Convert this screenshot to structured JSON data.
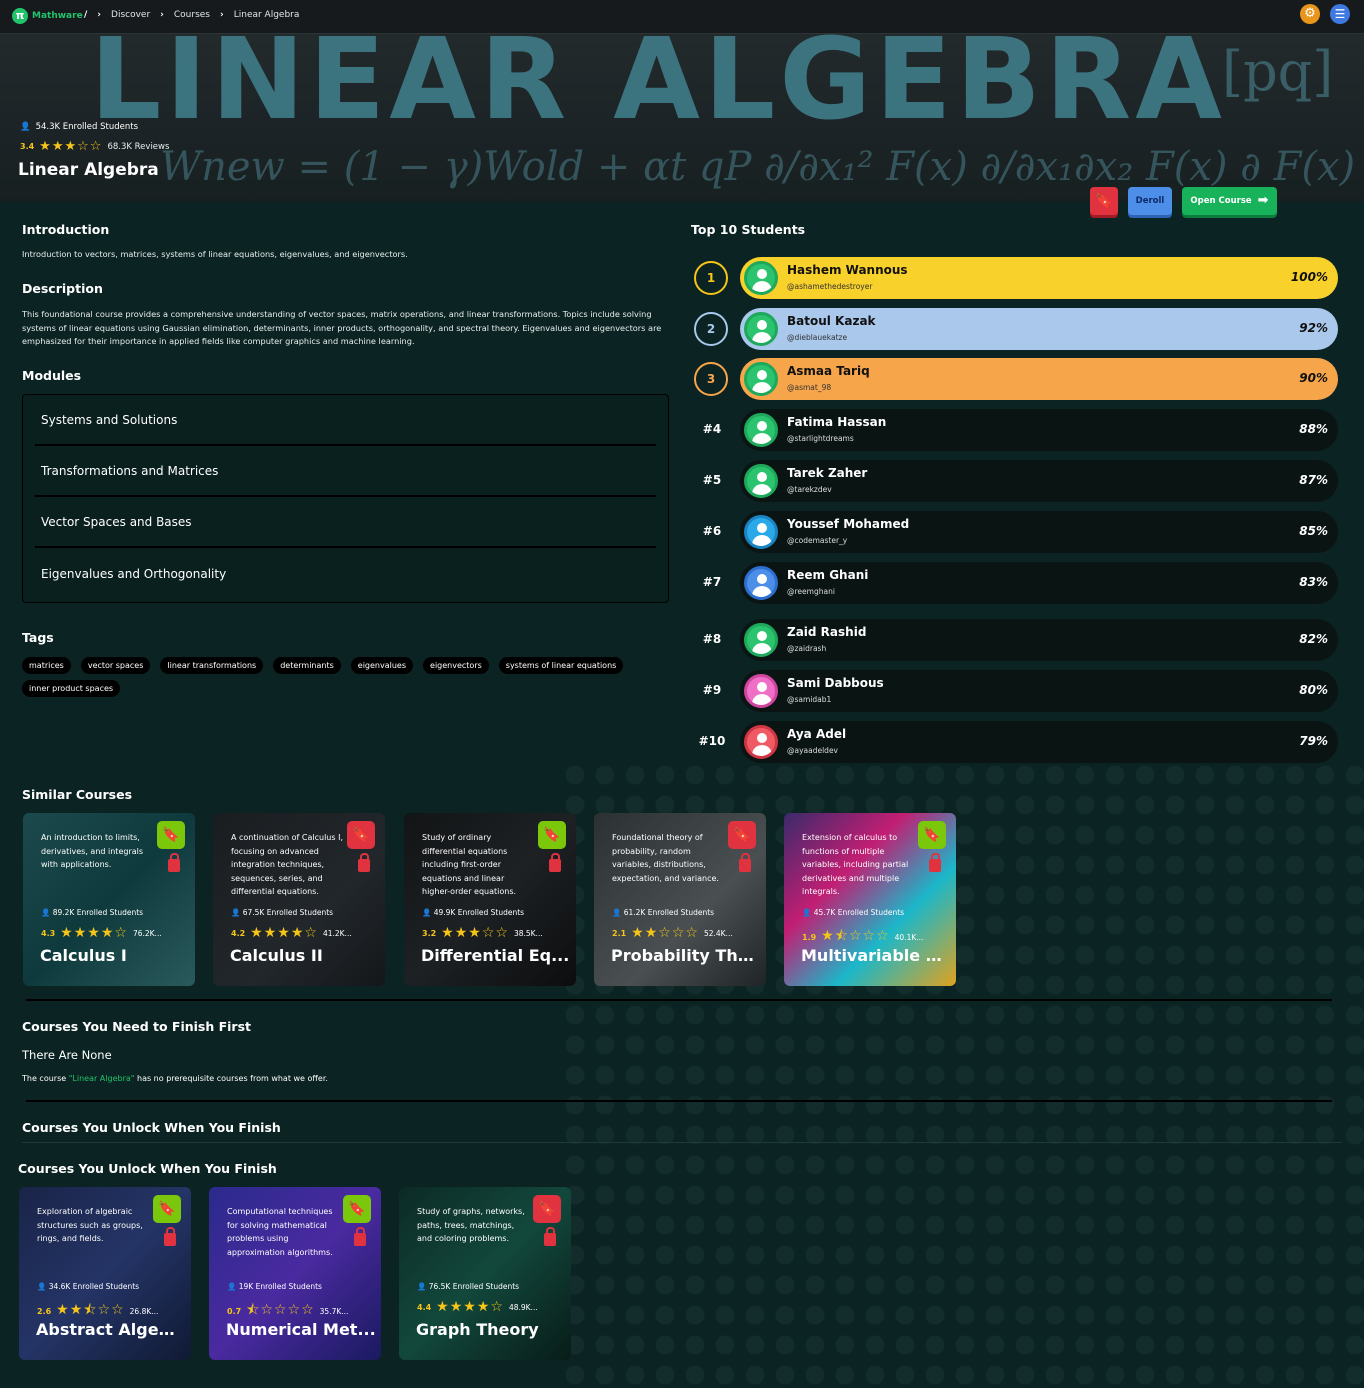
{
  "header": {
    "brand": "Mathware",
    "breadcrumbs": [
      "Discover",
      "Courses",
      "Linear Algebra"
    ],
    "settings_icon": "gear-icon",
    "menu_icon": "menu-icon"
  },
  "hero": {
    "banner_text": "LINEAR ALGEBRA",
    "banner_formula": "Wnew = (1 − γ)Wold + αt qP  ∂/∂x₁² F(x)  ∂/∂x₁∂x₂ F(x)  ∂ F(x)",
    "banner_matrix": "[pq]",
    "enrolled": "54.3K Enrolled Students",
    "rating": "3.4",
    "rating_value": 3.4,
    "reviews": "68.3K Reviews",
    "title": "Linear Algebra",
    "deroll_label": "Deroll",
    "open_label": "Open Course"
  },
  "introduction": {
    "heading": "Introduction",
    "text": "Introduction to vectors, matrices, systems of linear equations, eigenvalues, and eigenvectors."
  },
  "description": {
    "heading": "Description",
    "text": "This foundational course provides a comprehensive understanding of vector spaces, matrix operations, and linear transformations. Topics include solving systems of linear equations using Gaussian elimination, determinants, inner products, orthogonality, and spectral theory. Eigenvalues and eigenvectors are emphasized for their importance in applied fields like computer graphics and machine learning."
  },
  "modules": {
    "heading": "Modules",
    "items": [
      "Systems and Solutions",
      "Transformations and Matrices",
      "Vector Spaces and Bases",
      "Eigenvalues and Orthogonality"
    ]
  },
  "tags": {
    "heading": "Tags",
    "items": [
      "matrices",
      "vector spaces",
      "linear transformations",
      "determinants",
      "eigenvalues",
      "eigenvectors",
      "systems of linear equations",
      "inner product spaces"
    ]
  },
  "leaderboard": {
    "heading": "Top 10 Students",
    "students": [
      {
        "rank": "1",
        "name": "Hashem Wannous",
        "user": "@ashamethedestroyer",
        "pct": "100%"
      },
      {
        "rank": "2",
        "name": "Batoul Kazak",
        "user": "@dieblauekatze",
        "pct": "92%"
      },
      {
        "rank": "3",
        "name": "Asmaa Tariq",
        "user": "@asmat_98",
        "pct": "90%"
      },
      {
        "rank": "#4",
        "name": "Fatima Hassan",
        "user": "@starlightdreams",
        "pct": "88%"
      },
      {
        "rank": "#5",
        "name": "Tarek Zaher",
        "user": "@tarekzdev",
        "pct": "87%"
      },
      {
        "rank": "#6",
        "name": "Youssef Mohamed",
        "user": "@codemaster_y",
        "pct": "85%"
      },
      {
        "rank": "#7",
        "name": "Reem Ghani",
        "user": "@reemghani",
        "pct": "83%"
      },
      {
        "rank": "#8",
        "name": "Zaid Rashid",
        "user": "@zaidrash",
        "pct": "82%"
      },
      {
        "rank": "#9",
        "name": "Sami Dabbous",
        "user": "@samidab1",
        "pct": "80%"
      },
      {
        "rank": "#10",
        "name": "Aya Adel",
        "user": "@ayaadeldev",
        "pct": "79%"
      }
    ]
  },
  "similar": {
    "heading": "Similar Courses",
    "courses": [
      {
        "title": "Calculus I",
        "desc": "An introduction to limits, derivatives, and integrals with applications.",
        "enrolled": "89.2K Enrolled Students",
        "rating": "4.3",
        "rating_value": 4.3,
        "reviews": "76.2K...",
        "bookmark_color": "#7ac70c"
      },
      {
        "title": "Calculus II",
        "desc": "A continuation of Calculus I, focusing on advanced integration techniques, sequences, series, and differential equations.",
        "enrolled": "67.5K Enrolled Students",
        "rating": "4.2",
        "rating_value": 4.2,
        "reviews": "41.2K...",
        "bookmark_color": "#e0333f"
      },
      {
        "title": "Differential Eq...",
        "desc": "Study of ordinary differential equations including first-order equations and linear higher-order equations.",
        "enrolled": "49.9K Enrolled Students",
        "rating": "3.2",
        "rating_value": 3.2,
        "reviews": "38.5K...",
        "bookmark_color": "#7ac70c"
      },
      {
        "title": "Probability The...",
        "desc": "Foundational theory of probability, random variables, distributions, expectation, and variance.",
        "enrolled": "61.2K Enrolled Students",
        "rating": "2.1",
        "rating_value": 2.1,
        "reviews": "52.4K...",
        "bookmark_color": "#e0333f"
      },
      {
        "title": "Multivariable C...",
        "desc": "Extension of calculus to functions of multiple variables, including partial derivatives and multiple integrals.",
        "enrolled": "45.7K Enrolled Students",
        "rating": "1.9",
        "rating_value": 1.9,
        "reviews": "40.1K...",
        "bookmark_color": "#7ac70c"
      }
    ]
  },
  "prereq": {
    "heading": "Courses You Need to Finish First",
    "none": "There Are None",
    "note_prefix": "The course ",
    "note_course": "\"Linear Algebra\"",
    "note_suffix": " has no prerequisite courses from what we offer."
  },
  "unlock": {
    "heading1": "Courses You Unlock When You Finish",
    "heading2": "Courses You Unlock When You Finish",
    "courses": [
      {
        "title": "Abstract Algebra",
        "desc": "Exploration of algebraic structures such as groups, rings, and fields.",
        "enrolled": "34.6K Enrolled Students",
        "rating": "2.6",
        "rating_value": 2.6,
        "reviews": "26.8K...",
        "bookmark_color": "#7ac70c"
      },
      {
        "title": "Numerical Met...",
        "desc": "Computational techniques for solving mathematical problems using approximation algorithms.",
        "enrolled": "19K Enrolled Students",
        "rating": "0.7",
        "rating_value": 0.7,
        "reviews": "35.7K...",
        "bookmark_color": "#7ac70c"
      },
      {
        "title": "Graph Theory",
        "desc": "Study of graphs, networks, paths, trees, matchings, and coloring problems.",
        "enrolled": "76.5K Enrolled Students",
        "rating": "4.4",
        "rating_value": 4.4,
        "reviews": "48.9K...",
        "bookmark_color": "#e0333f"
      }
    ]
  },
  "colors": {
    "gold": "#f9d12b",
    "silver": "#a9c8ec",
    "bronze": "#f6a54b",
    "brand_green": "#21c46b",
    "star": "#f5c518"
  }
}
